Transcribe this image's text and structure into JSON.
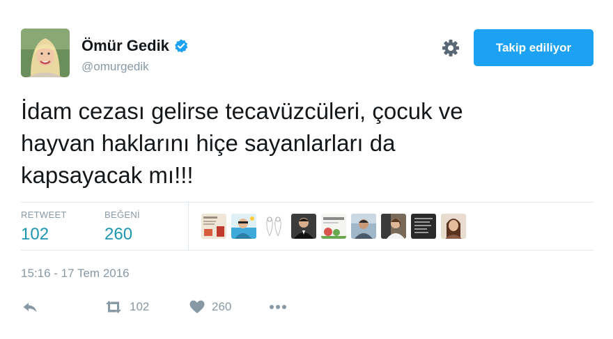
{
  "user": {
    "display_name": "Ömür Gedik",
    "username": "@omurgedik",
    "verified": true
  },
  "follow_button": {
    "label": "Takip ediliyor",
    "color": "#1da1f2"
  },
  "tweet": {
    "text_lines": [
      "İdam cezası gelirse tecavüzcüleri, çocuk ve",
      "hayvan haklarını hiçe sayanlarları da",
      "kapsayacak mı!!!"
    ]
  },
  "stats": {
    "retweets": {
      "label": "RETWEET",
      "value": "102"
    },
    "likes": {
      "label": "BEĞENİ",
      "value": "260"
    }
  },
  "likers": [
    {
      "icon": "liker-avatar"
    },
    {
      "icon": "liker-avatar"
    },
    {
      "icon": "liker-avatar"
    },
    {
      "icon": "liker-avatar"
    },
    {
      "icon": "liker-avatar"
    },
    {
      "icon": "liker-avatar"
    },
    {
      "icon": "liker-avatar"
    },
    {
      "icon": "liker-avatar"
    },
    {
      "icon": "liker-avatar"
    }
  ],
  "timestamp": "15:16 - 17 Tem 2016",
  "actions": {
    "reply": {
      "icon": "reply-icon"
    },
    "retweet": {
      "icon": "retweet-icon",
      "count": "102"
    },
    "like": {
      "icon": "heart-icon",
      "count": "260"
    },
    "more": {
      "icon": "more-icon"
    }
  },
  "colors": {
    "text": "#14171a",
    "secondary": "#8899a6",
    "stat_value": "#1b95b0",
    "divider": "#e1e8ed",
    "verified": "#1da1f2"
  }
}
